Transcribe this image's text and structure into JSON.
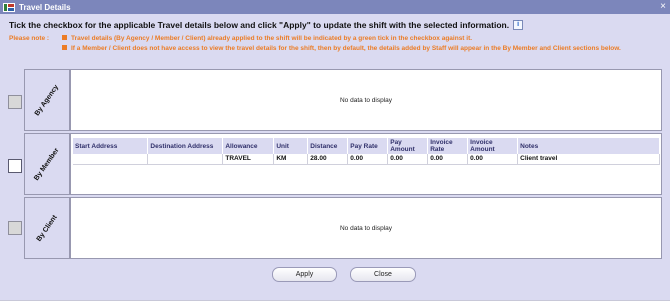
{
  "window": {
    "title": "Travel Details",
    "close_glyph": "×"
  },
  "heading": "Tick the checkbox for the applicable Travel details below and click \"Apply\" to update the shift with the selected information.",
  "info_glyph": "i",
  "notes": {
    "label": "Please note :",
    "items": [
      "Travel details (By Agency / Member / Client) already applied to the shift will be indicated by a green tick in the checkbox against it.",
      "If a Member / Client does not have access to view the travel details for the shift, then by default, the details added by Staff will appear in the By Member and Client sections below."
    ]
  },
  "sections": {
    "agency": {
      "label": "By Agency",
      "empty_text": "No data to display"
    },
    "member": {
      "label": "By Member",
      "columns": [
        "Start Address",
        "Destination Address",
        "Allowance",
        "Unit",
        "Distance",
        "Pay Rate",
        "Pay Amount",
        "Invoice Rate",
        "Invoice Amount",
        "Notes"
      ],
      "rows": [
        [
          "",
          "",
          "TRAVEL",
          "KM",
          "28.00",
          "0.00",
          "0.00",
          "0.00",
          "0.00",
          "Client travel"
        ]
      ]
    },
    "client": {
      "label": "By Client",
      "empty_text": "No data to display"
    }
  },
  "buttons": {
    "apply": "Apply",
    "close": "Close"
  },
  "colors": {
    "titlebar": "#7c86bb",
    "panel": "#dadaf1",
    "note": "#ec7c25"
  }
}
